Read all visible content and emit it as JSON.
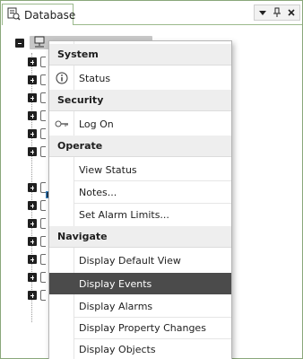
{
  "window": {
    "tab_title": "Database",
    "controls": {
      "dropdown": "▾",
      "pin": "ᵖ",
      "close": "×"
    },
    "border_color": "#8aa77a"
  },
  "tree": {
    "root_expanded": true,
    "collapsed_child_count": 15
  },
  "menu": {
    "sections": [
      {
        "header": "System",
        "items": [
          {
            "label": "Status",
            "icon": "info-icon"
          }
        ]
      },
      {
        "header": "Security",
        "items": [
          {
            "label": "Log On",
            "icon": "key-icon"
          }
        ]
      },
      {
        "header": "Operate",
        "items": [
          {
            "label": "View Status"
          },
          {
            "label": "Notes..."
          },
          {
            "label": "Set Alarm Limits..."
          }
        ]
      },
      {
        "header": "Navigate",
        "items": [
          {
            "label": "Display Default View"
          },
          {
            "label": "Display Events",
            "highlighted": true
          },
          {
            "label": "Display Alarms"
          },
          {
            "label": "Display Property Changes"
          },
          {
            "label": "Display Objects"
          }
        ]
      }
    ],
    "highlight_color": "#4b4b4b"
  }
}
